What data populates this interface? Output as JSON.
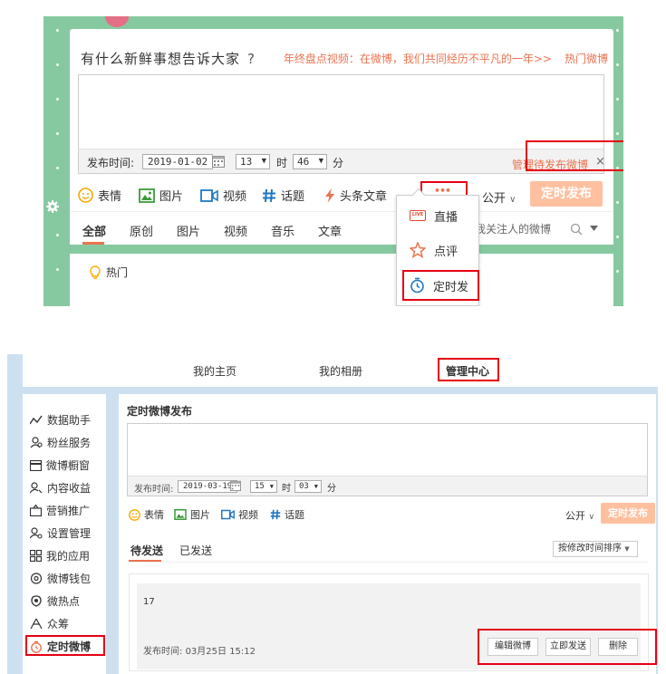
{
  "panel1": {
    "prompt": "有什么新鲜事想告诉大家",
    "prompt_help": "?",
    "topic_link": "年终盘点视频：在微博，我们共同经历不平凡的一年>>",
    "hot_link": "热门微博",
    "time_label": "发布时间:",
    "date": "2019-01-02",
    "hour": "13",
    "hour_unit": "时",
    "minute": "46",
    "minute_unit": "分",
    "manage_link": "管理待发布微博",
    "close": "×",
    "toolbar": {
      "emoji": "表情",
      "image": "图片",
      "video": "视频",
      "topic": "话题",
      "article": "头条文章",
      "more": "•••",
      "public": "公开",
      "public_caret": "∨",
      "schedule_btn": "定时发布"
    },
    "filter_tabs": [
      "全部",
      "原创",
      "图片",
      "视频",
      "音乐",
      "文章"
    ],
    "search_placeholder": "我关注人的微博",
    "hot_label": "热门",
    "dropdown": {
      "live": "直播",
      "live_badge": "LIVE",
      "review": "点评",
      "scheduled": "定时发"
    },
    "colors": {
      "accent": "#eb7350",
      "bg": "#86c9a0",
      "highlight": "#e60012"
    }
  },
  "panel2": {
    "top_tabs": [
      "我的主页",
      "我的相册",
      "管理中心"
    ],
    "sidebar": [
      "数据助手",
      "粉丝服务",
      "微博橱窗",
      "内容收益",
      "营销推广",
      "设置管理",
      "我的应用",
      "微博钱包",
      "微热点",
      "众筹",
      "定时微博"
    ],
    "title": "定时微博发布",
    "time_label": "发布时间:",
    "date": "2019-03-19",
    "hour": "15",
    "hour_unit": "时",
    "minute": "03",
    "minute_unit": "分",
    "toolbar": {
      "emoji": "表情",
      "image": "图片",
      "video": "视频",
      "topic": "话题",
      "public": "公开",
      "public_caret": "∨",
      "schedule_btn": "定时发布"
    },
    "subtabs": [
      "待发送",
      "已发送"
    ],
    "sort": "按修改时间排序",
    "sort_caret": "▼",
    "card": {
      "text": "17",
      "time_label": "发布时间:",
      "time": "03月25日 15:12",
      "edit": "编辑微博",
      "send_now": "立即发送",
      "delete": "删除"
    }
  }
}
